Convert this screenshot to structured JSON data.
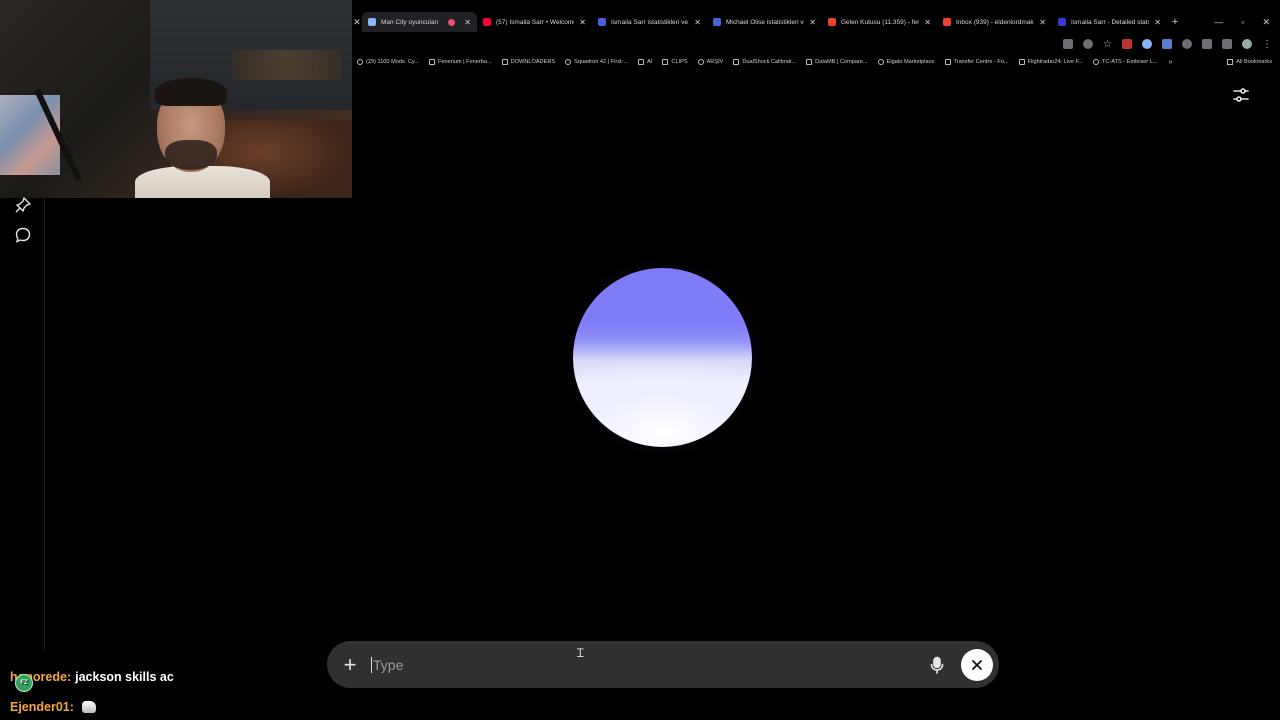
{
  "tabs": [
    {
      "title": "Man City oyuncuları",
      "active": true,
      "favicon_color": "#8ab4f8",
      "recording": true
    },
    {
      "title": "(57) Ismaila Sarr • Welcome t",
      "active": false,
      "favicon_color": "#ff0033"
    },
    {
      "title": "Ismaila Sarr istatistikleri ve re",
      "active": false,
      "favicon_color": "#4a61d8"
    },
    {
      "title": "Michael Olise istatistikleri ve s",
      "active": false,
      "favicon_color": "#4a61d8"
    },
    {
      "title": "Gelen Kutusu (11.359) - ferba",
      "active": false,
      "favicon_color": "#ea4335"
    },
    {
      "title": "Inbox (939) - eldenlordmakro",
      "active": false,
      "favicon_color": "#ea4335"
    },
    {
      "title": "Ismaila Sarr - Detailed stats | ",
      "active": false,
      "favicon_color": "#3a3ad0"
    }
  ],
  "bookmarks": [
    "(29) 1100 Mods. Cy...",
    "Fenerium | Fenerba...",
    "DOWNLOADERS",
    "Squadron 42 | First-...",
    "AI",
    "CLIPS",
    "ARŞİV",
    "DualShock Calibrati...",
    "DataMB | Compare...",
    "Elgato Marketplace",
    "Transfer Centre - Fo...",
    "Flightradar24: Live F...",
    "TC-ATS - Embraer L..."
  ],
  "bookmarks_more": "»",
  "bookmarks_all": "All Bookmarks",
  "composer": {
    "placeholder": "Type"
  },
  "chat": [
    {
      "user": "honorede:",
      "message": "jackson skills ac",
      "badge": "FZ"
    },
    {
      "user": "Ejender01:",
      "message": "",
      "emote": "ghost-emote"
    }
  ],
  "colors": {
    "orb_top": "#7e7bf6",
    "orb_bottom": "#eef0ff",
    "composer_bg": "#303030",
    "chat_user": "#f3a73b"
  }
}
